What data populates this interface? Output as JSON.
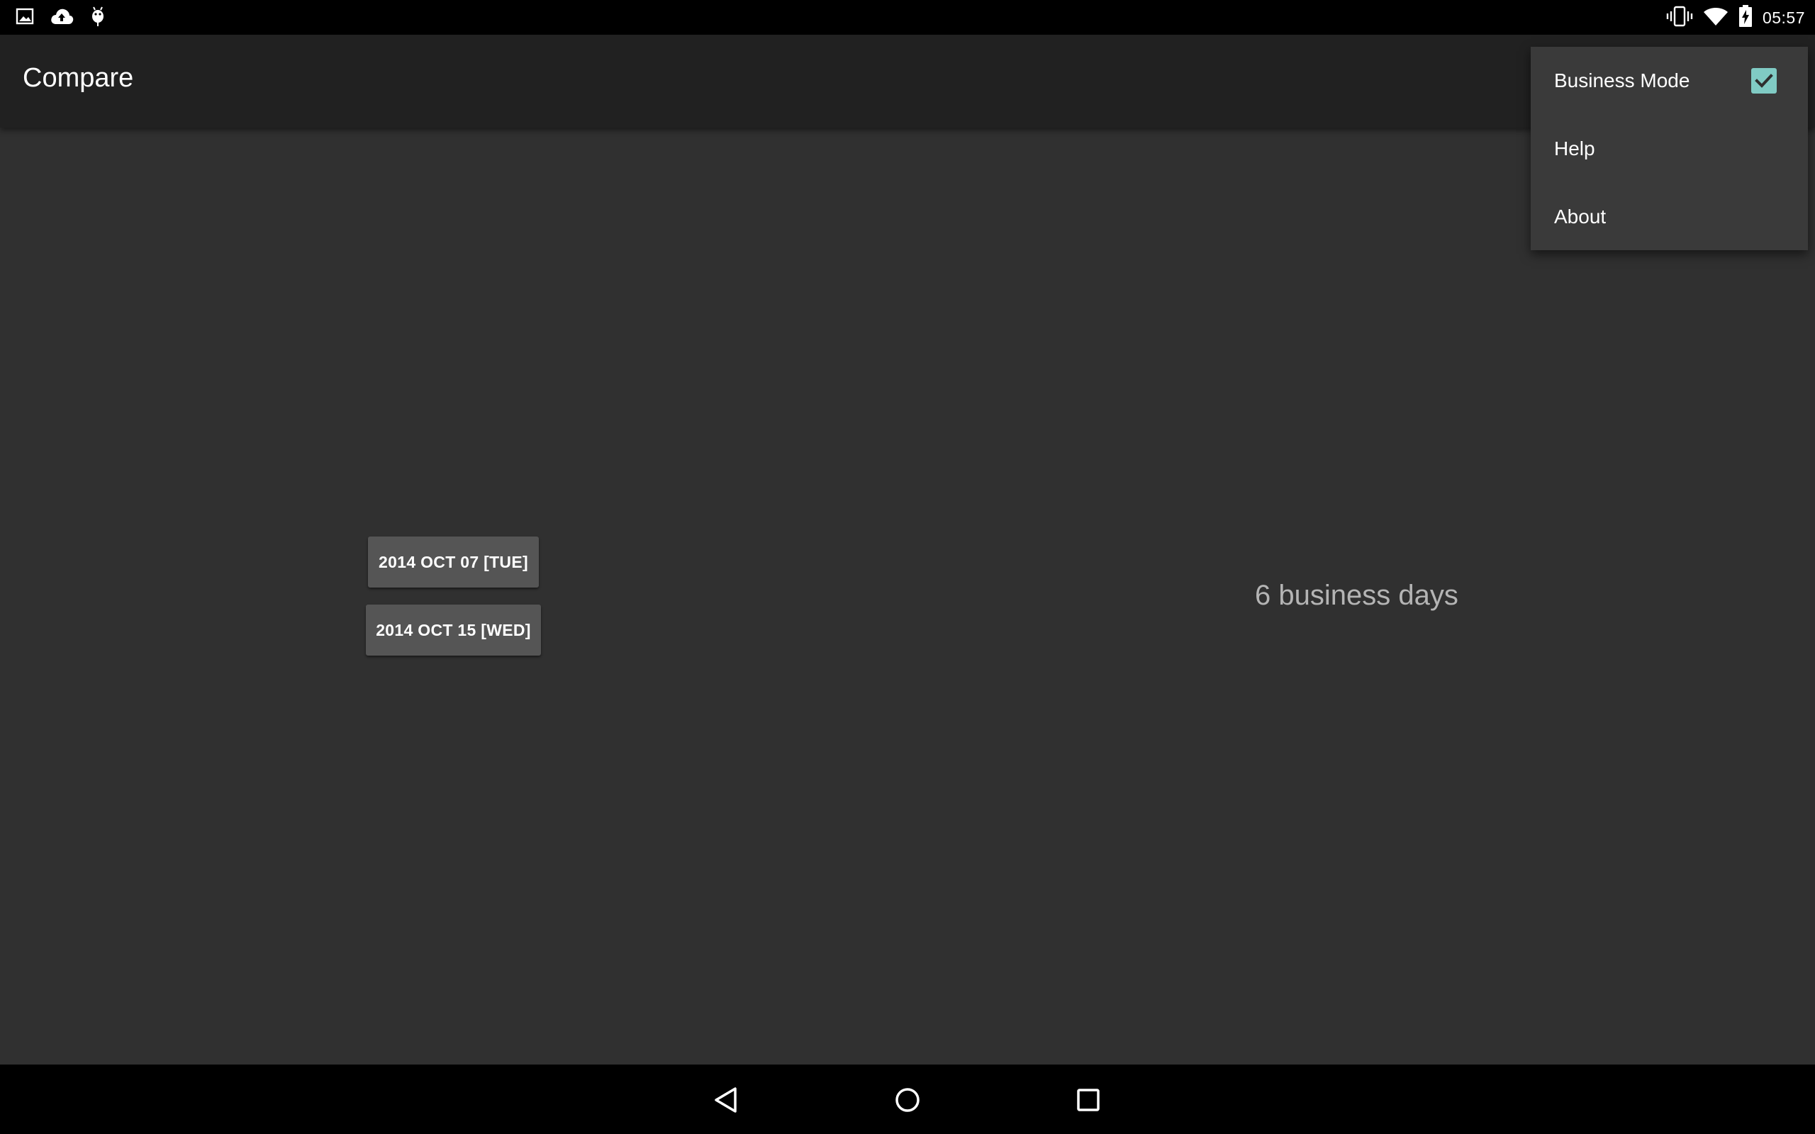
{
  "status_bar": {
    "time": "05:57",
    "left_icons": [
      "image-notification-icon",
      "cloud-upload-icon",
      "android-debug-icon"
    ],
    "right_icons": [
      "vibrate-icon",
      "wifi-icon",
      "battery-charging-icon"
    ]
  },
  "action_bar": {
    "title": "Compare"
  },
  "content": {
    "date_start": "2014 OCT 07 [TUE]",
    "date_end": "2014 OCT 15 [WED]",
    "result": "6 business days"
  },
  "overflow_menu": {
    "items": [
      {
        "label": "Business Mode",
        "checked": true
      },
      {
        "label": "Help"
      },
      {
        "label": "About"
      }
    ]
  },
  "nav_bar": {
    "buttons": [
      "back-icon",
      "home-icon",
      "recents-icon"
    ]
  },
  "colors": {
    "background": "#303030",
    "action_bar": "#212121",
    "menu_background": "#3a3a3a",
    "checkbox_accent": "#80cbc4",
    "button": "#555555",
    "result_text": "#b4b4b4"
  }
}
